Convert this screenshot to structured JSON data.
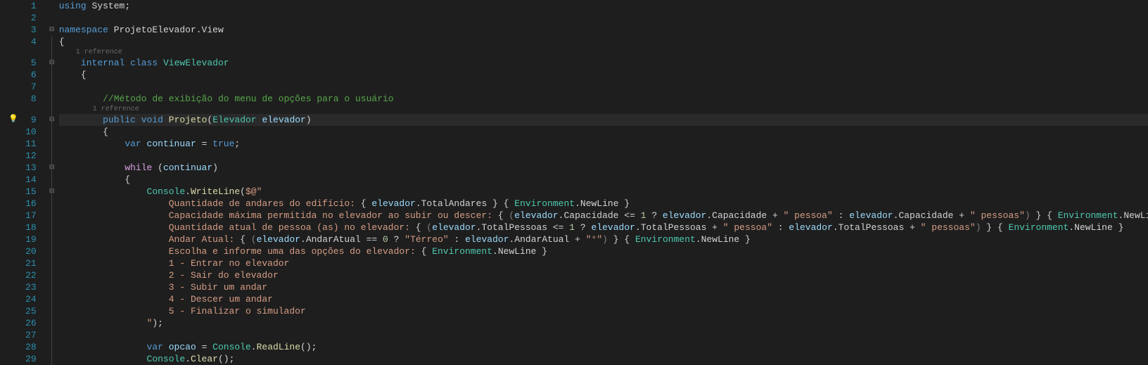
{
  "line_numbers": [
    "1",
    "2",
    "3",
    "4",
    "5",
    "6",
    "7",
    "8",
    "9",
    "10",
    "11",
    "12",
    "13",
    "14",
    "15",
    "16",
    "17",
    "18",
    "19",
    "20",
    "21",
    "22",
    "23",
    "24",
    "25",
    "26",
    "27",
    "28",
    "29"
  ],
  "codelens": {
    "class_ref": "1 reference",
    "method_ref": "1 reference"
  },
  "tokens": {
    "using": "using",
    "system": "System",
    "namespace": "namespace",
    "ns_name": "ProjetoElevador.View",
    "internal": "internal",
    "class": "class",
    "class_name": "ViewElevador",
    "comment_menu": "//Método de exibição do menu de opções para o usuário",
    "public": "public",
    "void": "void",
    "method_name": "Projeto",
    "param_type": "Elevador",
    "param_name": "elevador",
    "var": "var",
    "continuar": "continuar",
    "true": "true",
    "while": "while",
    "console": "Console",
    "writeline": "WriteLine",
    "interp_open": "$@\"",
    "s_andares_pre": "Quantidade de andares do edifício: ",
    "elev": "elevador",
    "total_andares": "TotalAndares",
    "env": "Environment",
    "newline": "NewLine",
    "s_cap_pre": "Capacidade máxima permitida no elevador ao subir ou descer: ",
    "capacidade": "Capacidade",
    "lt1": " <= ",
    "one": "1",
    "q": " ? ",
    "colon": " : ",
    "pessoa": "\" pessoa\"",
    "pessoas": "\" pessoas\"",
    "plus": " + ",
    "s_qtd_pre": "Quantidade atual de pessoa (as) no elevador: ",
    "total_pessoas": "TotalPessoas",
    "s_andar_pre": "Andar Atual: ",
    "andar_atual": "AndarAtual",
    "eq0": " == ",
    "zero": "0",
    "terreo": "\"Térreo\"",
    "grau": "\"°\"",
    "s_escolha": "Escolha e informe uma das opções do elevador: ",
    "opt1": "1 - Entrar no elevador",
    "opt2": "2 - Sair do elevador",
    "opt3": "3 - Subir um andar",
    "opt4": "4 - Descer um andar",
    "opt5": "5 - Finalizar o simulador",
    "str_close": "\"",
    "opcao": "opcao",
    "readline": "ReadLine",
    "clear": "Clear"
  }
}
